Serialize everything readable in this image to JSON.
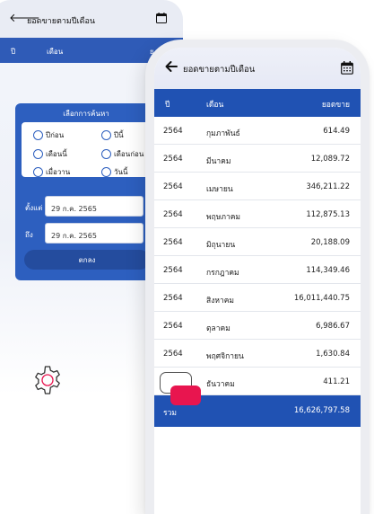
{
  "back_screen": {
    "title": "ยอดขายตามปีเดือน",
    "columns": [
      "ปี",
      "เดือน",
      "ย"
    ],
    "dialog": {
      "title": "เลือกการค้นหา",
      "options": [
        "ปีก่อน",
        "ปีนี้",
        "เดือนนี้",
        "เดือนก่อน",
        "เมื่อวาน",
        "วันนี้"
      ],
      "from_label": "ตั้งแต่",
      "from_value": "29 ก.ค. 2565",
      "to_label": "ถึง",
      "to_value": "29 ก.ค. 2565",
      "ok_label": "ตกลง"
    }
  },
  "front_screen": {
    "title": "ยอดขายตามปีเดือน",
    "columns": {
      "year": "ปี",
      "month": "เดือน",
      "sales": "ยอดขาย"
    },
    "rows": [
      {
        "year": "2564",
        "month": "กุมภาพันธ์",
        "sales": "614.49"
      },
      {
        "year": "2564",
        "month": "มีนาคม",
        "sales": "12,089.72"
      },
      {
        "year": "2564",
        "month": "เมษายน",
        "sales": "346,211.22"
      },
      {
        "year": "2564",
        "month": "พฤษภาคม",
        "sales": "112,875.13"
      },
      {
        "year": "2564",
        "month": "มิถุนายน",
        "sales": "20,188.09"
      },
      {
        "year": "2564",
        "month": "กรกฎาคม",
        "sales": "114,349.46"
      },
      {
        "year": "2564",
        "month": "สิงหาคม",
        "sales": "16,011,440.75"
      },
      {
        "year": "2564",
        "month": "ตุลาคม",
        "sales": "6,986.67"
      },
      {
        "year": "2564",
        "month": "พฤศจิกายน",
        "sales": "1,630.84"
      },
      {
        "year": "2564",
        "month": "ธันวาคม",
        "sales": "411.21"
      }
    ],
    "total_label": "รวม",
    "total_value": "16,626,797.58"
  },
  "colors": {
    "primary_blue": "#2052b3",
    "dialog_blue": "#2d5fbf",
    "accent_pink": "#e8154f"
  },
  "icons": [
    "back-arrow-icon",
    "calendar-icon",
    "gear-icon"
  ]
}
